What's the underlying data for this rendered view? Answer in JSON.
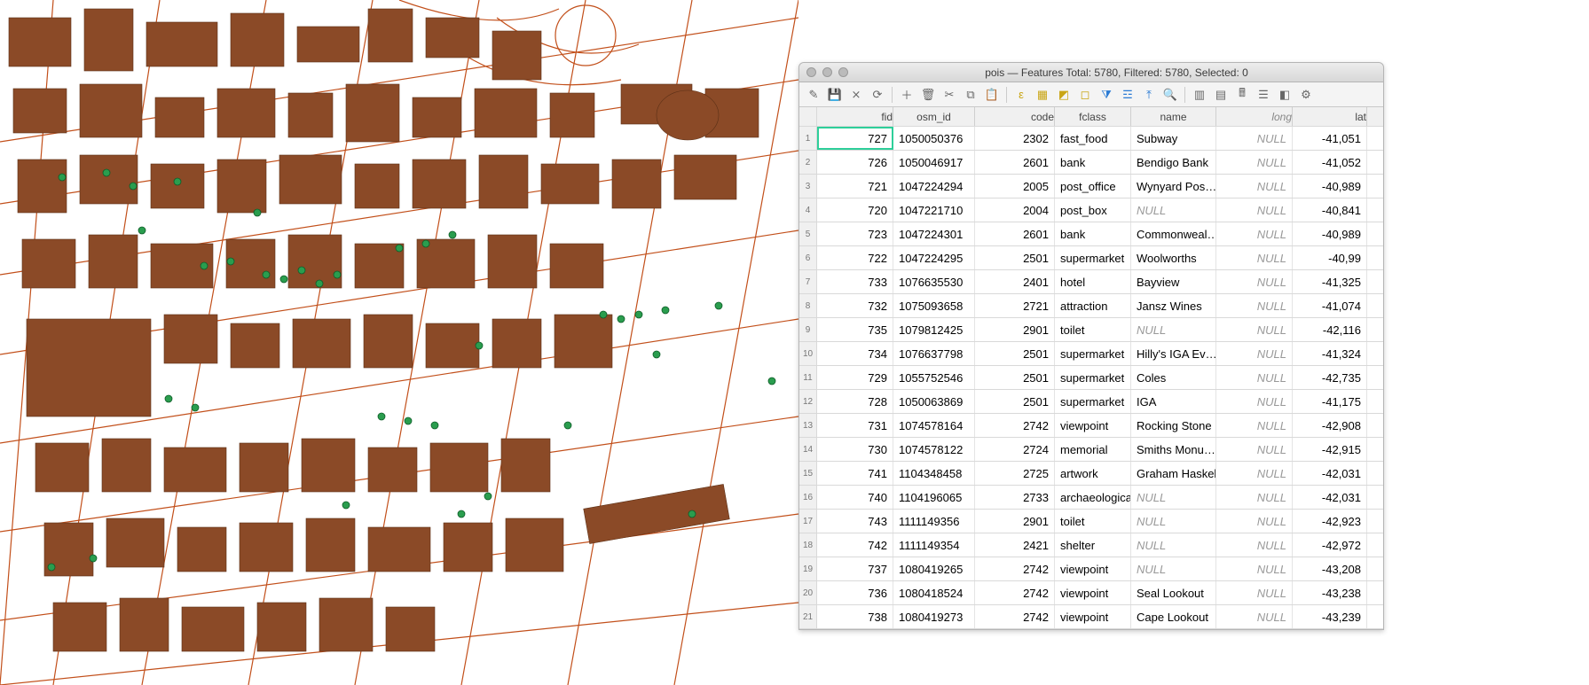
{
  "window": {
    "title": "pois — Features Total: 5780, Filtered: 5780, Selected: 0"
  },
  "toolbar_icons": [
    "pencil-icon",
    "save-edits-icon",
    "discard-edits-icon",
    "refresh-icon",
    "add-feature-icon",
    "delete-feature-icon",
    "cut-icon",
    "copy-icon",
    "paste-icon",
    "expression-icon",
    "select-all-icon",
    "invert-selection-icon",
    "deselect-icon",
    "filter-icon",
    "filter-form-icon",
    "move-top-icon",
    "zoom-icon",
    "new-column-icon",
    "delete-column-icon",
    "calculator-icon",
    "conditional-format-icon",
    "dock-icon",
    "actions-icon"
  ],
  "columns": [
    "fid",
    "osm_id",
    "code",
    "fclass",
    "name",
    "long",
    "lat"
  ],
  "rows": [
    {
      "n": "1",
      "fid": "727",
      "osm": "1050050376",
      "code": "2302",
      "fclass": "fast_food",
      "name": "Subway",
      "long": "NULL",
      "lat": "-41,051"
    },
    {
      "n": "2",
      "fid": "726",
      "osm": "1050046917",
      "code": "2601",
      "fclass": "bank",
      "name": "Bendigo Bank",
      "long": "NULL",
      "lat": "-41,052"
    },
    {
      "n": "3",
      "fid": "721",
      "osm": "1047224294",
      "code": "2005",
      "fclass": "post_office",
      "name": "Wynyard Pos…",
      "long": "NULL",
      "lat": "-40,989"
    },
    {
      "n": "4",
      "fid": "720",
      "osm": "1047221710",
      "code": "2004",
      "fclass": "post_box",
      "name": "NULL",
      "long": "NULL",
      "lat": "-40,841"
    },
    {
      "n": "5",
      "fid": "723",
      "osm": "1047224301",
      "code": "2601",
      "fclass": "bank",
      "name": "Commonweal…",
      "long": "NULL",
      "lat": "-40,989"
    },
    {
      "n": "6",
      "fid": "722",
      "osm": "1047224295",
      "code": "2501",
      "fclass": "supermarket",
      "name": "Woolworths",
      "long": "NULL",
      "lat": "-40,99"
    },
    {
      "n": "7",
      "fid": "733",
      "osm": "1076635530",
      "code": "2401",
      "fclass": "hotel",
      "name": "Bayview",
      "long": "NULL",
      "lat": "-41,325"
    },
    {
      "n": "8",
      "fid": "732",
      "osm": "1075093658",
      "code": "2721",
      "fclass": "attraction",
      "name": "Jansz Wines",
      "long": "NULL",
      "lat": "-41,074"
    },
    {
      "n": "9",
      "fid": "735",
      "osm": "1079812425",
      "code": "2901",
      "fclass": "toilet",
      "name": "NULL",
      "long": "NULL",
      "lat": "-42,116"
    },
    {
      "n": "10",
      "fid": "734",
      "osm": "1076637798",
      "code": "2501",
      "fclass": "supermarket",
      "name": "Hilly's IGA Ev…",
      "long": "NULL",
      "lat": "-41,324"
    },
    {
      "n": "11",
      "fid": "729",
      "osm": "1055752546",
      "code": "2501",
      "fclass": "supermarket",
      "name": "Coles",
      "long": "NULL",
      "lat": "-42,735"
    },
    {
      "n": "12",
      "fid": "728",
      "osm": "1050063869",
      "code": "2501",
      "fclass": "supermarket",
      "name": "IGA",
      "long": "NULL",
      "lat": "-41,175"
    },
    {
      "n": "13",
      "fid": "731",
      "osm": "1074578164",
      "code": "2742",
      "fclass": "viewpoint",
      "name": "Rocking Stone",
      "long": "NULL",
      "lat": "-42,908"
    },
    {
      "n": "14",
      "fid": "730",
      "osm": "1074578122",
      "code": "2724",
      "fclass": "memorial",
      "name": "Smiths Monu…",
      "long": "NULL",
      "lat": "-42,915"
    },
    {
      "n": "15",
      "fid": "741",
      "osm": "1104348458",
      "code": "2725",
      "fclass": "artwork",
      "name": "Graham Haskell",
      "long": "NULL",
      "lat": "-42,031"
    },
    {
      "n": "16",
      "fid": "740",
      "osm": "1104196065",
      "code": "2733",
      "fclass": "archaeological",
      "name": "NULL",
      "long": "NULL",
      "lat": "-42,031"
    },
    {
      "n": "17",
      "fid": "743",
      "osm": "1111149356",
      "code": "2901",
      "fclass": "toilet",
      "name": "NULL",
      "long": "NULL",
      "lat": "-42,923"
    },
    {
      "n": "18",
      "fid": "742",
      "osm": "1111149354",
      "code": "2421",
      "fclass": "shelter",
      "name": "NULL",
      "long": "NULL",
      "lat": "-42,972"
    },
    {
      "n": "19",
      "fid": "737",
      "osm": "1080419265",
      "code": "2742",
      "fclass": "viewpoint",
      "name": "NULL",
      "long": "NULL",
      "lat": "-43,208"
    },
    {
      "n": "20",
      "fid": "736",
      "osm": "1080418524",
      "code": "2742",
      "fclass": "viewpoint",
      "name": "Seal Lookout",
      "long": "NULL",
      "lat": "-43,238"
    },
    {
      "n": "21",
      "fid": "738",
      "osm": "1080419273",
      "code": "2742",
      "fclass": "viewpoint",
      "name": "Cape Lookout",
      "long": "NULL",
      "lat": "-43,239"
    }
  ],
  "map": {
    "building_fill": "#8b4a27",
    "road_stroke": "#c24f1a",
    "poi_fill": "#2a9d4e"
  }
}
